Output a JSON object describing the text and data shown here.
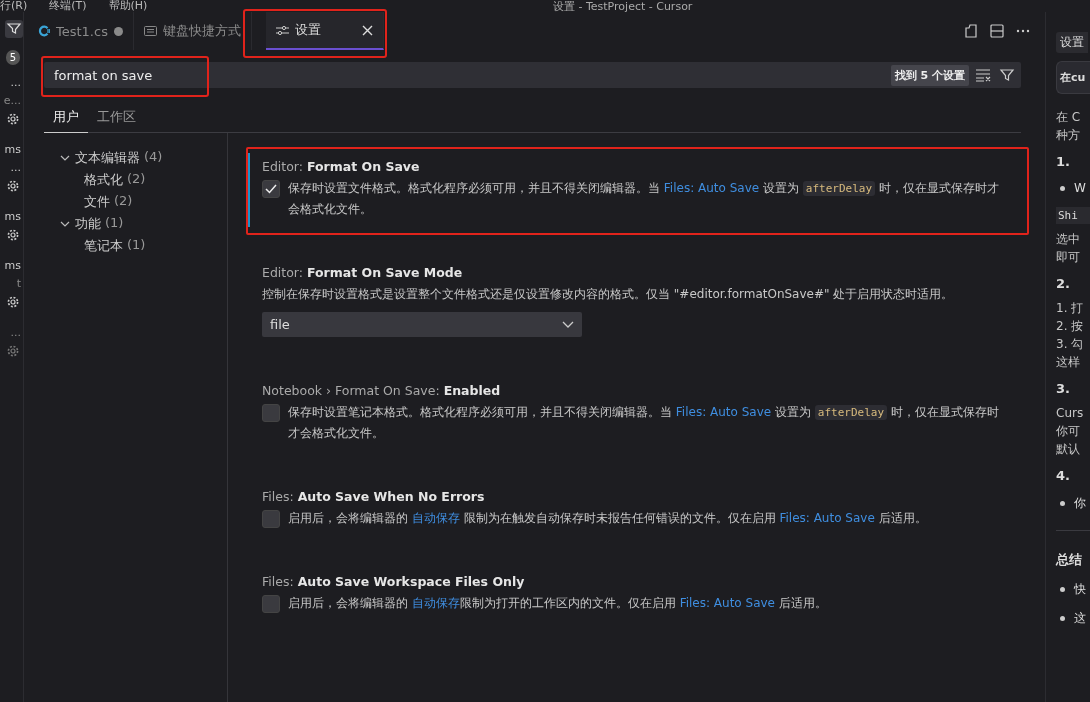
{
  "window": {
    "title": "设置 - TestProject - Cursor"
  },
  "menu": [
    "行(R)",
    "终端(T)",
    "帮助(H)"
  ],
  "left_strip": [
    {
      "kind": "filter"
    },
    {
      "kind": "badge",
      "text": "5"
    },
    {
      "kind": "text",
      "text": "..."
    },
    {
      "kind": "dim",
      "text": "e..."
    },
    {
      "kind": "gear"
    },
    {
      "kind": "text",
      "text": "ms"
    },
    {
      "kind": "text",
      "text": "..."
    },
    {
      "kind": "gear"
    },
    {
      "kind": "text",
      "text": "ms"
    },
    {
      "kind": "gear"
    },
    {
      "kind": "text",
      "text": "ms"
    },
    {
      "kind": "dim",
      "text": "t"
    },
    {
      "kind": "gear"
    },
    {
      "kind": "dim",
      "text": "..."
    },
    {
      "kind": "gear-dim"
    }
  ],
  "tabs": [
    {
      "label": "Test1.cs",
      "selected": false,
      "modified": true,
      "highlighted": false
    },
    {
      "label": "键盘快捷方式",
      "selected": false,
      "modified": false,
      "highlighted": false
    },
    {
      "label": "设置",
      "selected": true,
      "modified": false,
      "highlighted": true
    }
  ],
  "search": {
    "value": "format on save",
    "result_count": "找到 5 个设置",
    "highlighted": true
  },
  "scopes": [
    {
      "label": "用户",
      "selected": true
    },
    {
      "label": "工作区",
      "selected": false
    }
  ],
  "tree": [
    {
      "label": "文本编辑器",
      "count": "(4)",
      "expanded": true,
      "children": [
        {
          "label": "格式化",
          "count": "(2)"
        },
        {
          "label": "文件",
          "count": "(2)"
        }
      ]
    },
    {
      "label": "功能",
      "count": "(1)",
      "expanded": true,
      "children": [
        {
          "label": "笔记本",
          "count": "(1)"
        }
      ]
    }
  ],
  "settings": [
    {
      "category": "Editor: ",
      "title": "Format On Save",
      "kind": "checkbox",
      "checked": true,
      "focused": true,
      "highlighted": true,
      "description": [
        {
          "text": "保存时设置文件格式。格式化程序必须可用，并且不得关闭编辑器。当 "
        },
        {
          "link": "Files: Auto Save"
        },
        {
          "text": " 设置为 "
        },
        {
          "code": "afterDelay"
        },
        {
          "text": " 时，仅在显式保存时才会格式化文件。"
        }
      ]
    },
    {
      "category": "Editor: ",
      "title": "Format On Save Mode",
      "kind": "select",
      "value": "file",
      "focused": false,
      "highlighted": false,
      "description": [
        {
          "text": "控制在保存时设置格式是设置整个文件格式还是仅设置修改内容的格式。仅当 \"#editor.formatOnSave#\" 处于启用状态时适用。"
        }
      ]
    },
    {
      "category": "Notebook › Format On Save: ",
      "title": "Enabled",
      "kind": "checkbox",
      "checked": false,
      "focused": false,
      "highlighted": false,
      "description": [
        {
          "text": "保存时设置笔记本格式。格式化程序必须可用，并且不得关闭编辑器。当 "
        },
        {
          "link": "Files: Auto Save"
        },
        {
          "text": " 设置为 "
        },
        {
          "code": "afterDelay"
        },
        {
          "text": " 时，仅在显式保存时才会格式化文件。"
        }
      ]
    },
    {
      "category": "Files: ",
      "title": "Auto Save When No Errors",
      "kind": "checkbox",
      "checked": false,
      "focused": false,
      "highlighted": false,
      "description": [
        {
          "text": "启用后，会将编辑器的 "
        },
        {
          "link": "自动保存"
        },
        {
          "text": " 限制为在触发自动保存时未报告任何错误的文件。仅在启用 "
        },
        {
          "link": "Files: Auto Save"
        },
        {
          "text": " 后适用。"
        }
      ]
    },
    {
      "category": "Files: ",
      "title": "Auto Save Workspace Files Only",
      "kind": "checkbox",
      "checked": false,
      "focused": false,
      "highlighted": false,
      "description": [
        {
          "text": "启用后，会将编辑器的 "
        },
        {
          "link": "自动保存"
        },
        {
          "text": "限制为打开的工作区内的文件。仅在启用 "
        },
        {
          "link": "Files: Auto Save"
        },
        {
          "text": " 后适用。"
        }
      ]
    }
  ],
  "right_panel": {
    "tab": "设置",
    "input": "在cu",
    "lines": [
      {
        "kind": "para",
        "text": "在 C"
      },
      {
        "kind": "para",
        "text": "种方"
      },
      {
        "kind": "heading",
        "text": "1."
      },
      {
        "kind": "bullet",
        "text": "W"
      },
      {
        "kind": "code",
        "text": "Shi"
      },
      {
        "kind": "para",
        "text": "选中"
      },
      {
        "kind": "para",
        "text": "即可"
      },
      {
        "kind": "heading",
        "text": "2."
      },
      {
        "kind": "para",
        "text": "1. 打"
      },
      {
        "kind": "para",
        "text": "2. 按"
      },
      {
        "kind": "para",
        "text": "3. 勾"
      },
      {
        "kind": "para",
        "text": "这样"
      },
      {
        "kind": "heading",
        "text": "3."
      },
      {
        "kind": "para",
        "text": "Curs"
      },
      {
        "kind": "para",
        "text": "你可"
      },
      {
        "kind": "para",
        "text": "默认"
      },
      {
        "kind": "heading",
        "text": "4."
      },
      {
        "kind": "bullet",
        "text": "你"
      },
      {
        "kind": "rule"
      },
      {
        "kind": "heading",
        "text": "总结"
      },
      {
        "kind": "bullet",
        "text": "快"
      },
      {
        "kind": "bullet",
        "text": "这"
      }
    ]
  }
}
